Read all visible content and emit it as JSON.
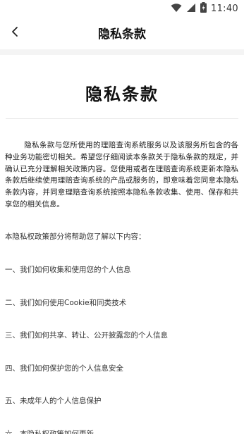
{
  "status_bar": {
    "time": "11:40",
    "icons": [
      "wifi-icon",
      "signal-icon",
      "battery-icon"
    ]
  },
  "app_bar": {
    "title": "隐私条款",
    "back_icon": "chevron-left-icon"
  },
  "document": {
    "title": "隐私条款",
    "intro": "隐私条款与您所使用的理赔查询系统服务以及该服务所包含的各种业务功能密切相关。希望您仔细阅读本条款关于隐私条款的规定，并确认已充分理解相关政策内容。您使用或者在理赔查询系统更新本隐私条款后继续使用理赔查询系统的产品或服务的，即意味着您同意本隐私条款内容，并同意理赔查询系统按照本隐私条款收集、使用、保存和共享您的相关信息。",
    "toc_lead": "本隐私权政策部分将帮助您了解以下内容：",
    "toc": [
      "一、我们如何收集和使用您的个人信息",
      "二、我们如何使用Cookie和同类技术",
      "三、我们如何共享、转让、公开披露您的个人信息",
      "四、我们如何保护您的个人信息安全",
      "五、未成年人的个人信息保护",
      "六、本隐私权政策如何更新"
    ]
  },
  "colors": {
    "background": "#ffffff",
    "band": "#f4f4f4",
    "text": "#222222"
  }
}
